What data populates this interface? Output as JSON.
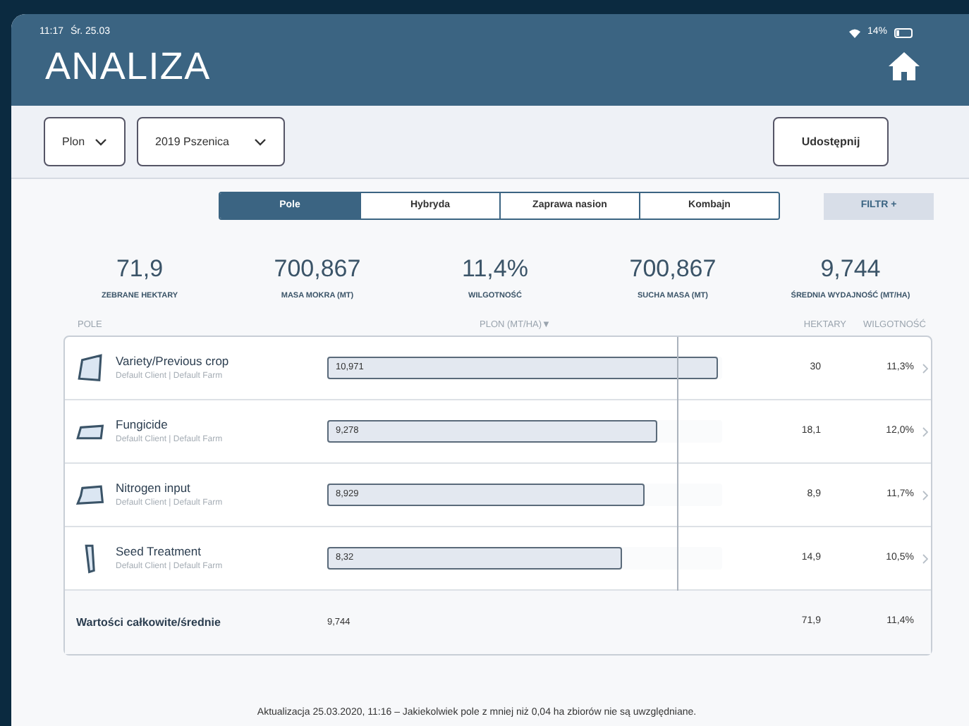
{
  "status_bar": {
    "time": "11:17",
    "date": "Śr. 25.03",
    "battery": "14%"
  },
  "header": {
    "title": "ANALIZA"
  },
  "toolbar": {
    "dropdowns": [
      {
        "value": "Plon"
      },
      {
        "value": "2019 Pszenica"
      }
    ],
    "share_button": "Udostępnij"
  },
  "tabs": [
    {
      "label": "Pole",
      "selected": true
    },
    {
      "label": "Hybryda",
      "selected": false
    },
    {
      "label": "Zaprawa nasion",
      "selected": false
    },
    {
      "label": "Kombajn",
      "selected": false
    }
  ],
  "filter_button": "FILTR +",
  "stats": [
    {
      "value": "71,9",
      "label": "ZEBRANE HEKTARY"
    },
    {
      "value": "700,867",
      "label": "MASA MOKRA (MT)"
    },
    {
      "value": "11,4%",
      "label": "WILGOTNOŚĆ"
    },
    {
      "value": "700,867",
      "label": "SUCHA MASA (MT)"
    },
    {
      "value": "9,744",
      "label": "ŚREDNIA WYDAJNOŚĆ (MT/HA)"
    }
  ],
  "table": {
    "columns": [
      "POLE",
      "PLON (MT/HA)▼",
      "HEKTARY",
      "WILGOTNOŚĆ"
    ],
    "rows": [
      {
        "name": "Variety/Previous crop",
        "subtitle": "Default Client | Default Farm",
        "yield": "10,971",
        "level": 0.99,
        "hectares": "30",
        "moisture": "11,3%"
      },
      {
        "name": "Fungicide",
        "subtitle": "Default Client | Default Farm",
        "yield": "9,278",
        "level": 0.836,
        "hectares": "18,1",
        "moisture": "12,0%"
      },
      {
        "name": "Nitrogen input",
        "subtitle": "Default Client | Default Farm",
        "yield": "8,929",
        "level": 0.804,
        "hectares": "8,9",
        "moisture": "11,7%"
      },
      {
        "name": "Seed Treatment",
        "subtitle": "Default Client | Default Farm",
        "yield": "8,32",
        "level": 0.746,
        "hectares": "14,9",
        "moisture": "10,5%"
      }
    ],
    "totals": {
      "label": "Wartości całkowite/średnie",
      "yield": "9,744",
      "hectares": "71,9",
      "moisture": "11,4%"
    }
  },
  "footer_note": "Aktualizacja 25.03.2020, 11:16 – Jakiekolwiek pole z mniej niż 0,04 ha zbiorów nie są uwzględniane."
}
